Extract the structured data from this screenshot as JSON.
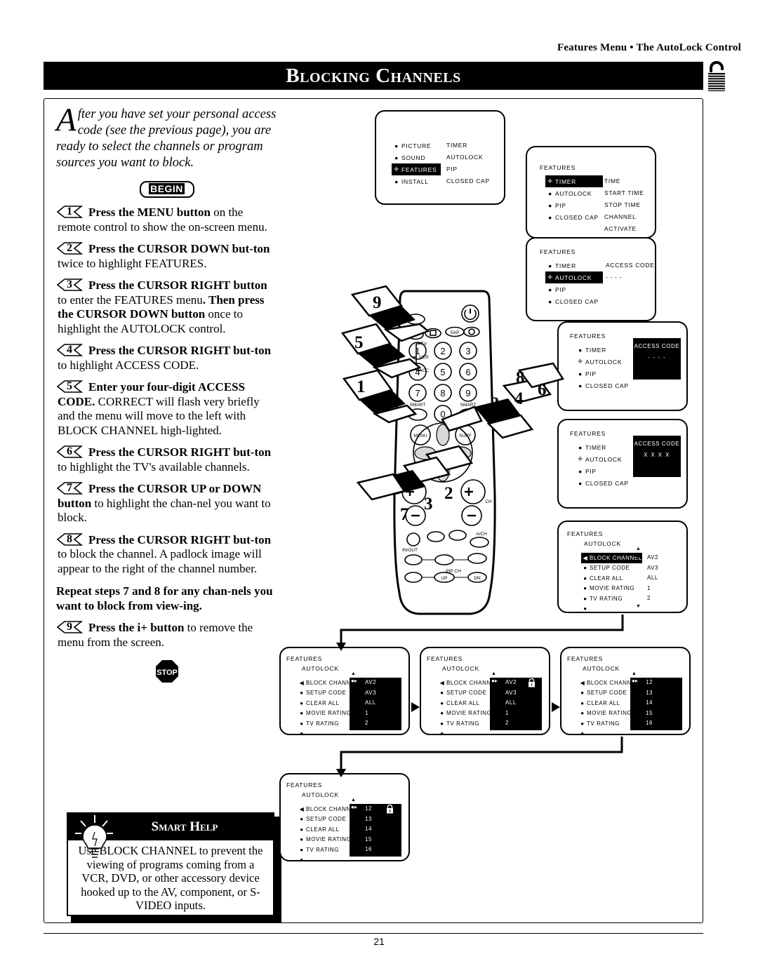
{
  "page": {
    "running_head": "Features Menu • The AutoLock Control",
    "title": "Blocking Channels",
    "page_number": "21",
    "lock_icon": "open-padlock-icon"
  },
  "intro": {
    "dropcap": "A",
    "text": "fter you have set your personal access code (see the previous page), you are ready to select the channels or program sources you want to block.",
    "begin_label": "BEGIN",
    "stop_label": "STOP"
  },
  "steps": [
    {
      "num": "1",
      "bold": "Press the MENU button",
      "rest": " on the remote control to show the on-screen menu."
    },
    {
      "num": "2",
      "bold": "Press the CURSOR DOWN but-",
      "rest": ""
    },
    {
      "num": "3",
      "bold": "Press the CURSOR RIGHT",
      "rest": ""
    },
    {
      "num": "4",
      "bold": "Press the CURSOR RIGHT but-",
      "rest": ""
    },
    {
      "num": "5",
      "bold": "Enter your four-digit ACCESS",
      "rest": ""
    },
    {
      "num": "6",
      "bold": "Press the CURSOR RIGHT but-",
      "rest": ""
    },
    {
      "num": "7",
      "bold": "Press the CURSOR UP or",
      "rest": ""
    },
    {
      "num": "8",
      "bold": "Press the CURSOR RIGHT but-",
      "rest": ""
    },
    {
      "num": "9",
      "bold": "Press the i+ button",
      "rest": " to remove the menu from the screen."
    }
  ],
  "step_text": {
    "s1_a": "Press the MENU button",
    "s1_b": " on the remote control to show the on-screen menu.",
    "s2_a": "Press the CURSOR DOWN but-",
    "s2_b": "ton",
    "s2_c": " twice to highlight FEATURES.",
    "s3_a": "Press the CURSOR RIGHT",
    "s3_b": "button",
    "s3_c": " to enter the FEATURES menu",
    "s3_d": ". Then ",
    "s3_e": "press the CURSOR DOWN button",
    "s3_f": " once to highlight the AUTOLOCK control.",
    "s4_a": "Press the CURSOR RIGHT but-",
    "s4_b": "ton",
    "s4_c": " to highlight ACCESS CODE.",
    "s5_a": "Enter your four-digit ACCESS CODE.",
    "s5_b": " CORRECT will flash very briefly and the menu will move to the left with BLOCK CHANNEL high-lighted.",
    "s6_a": "Press the CURSOR RIGHT but-",
    "s6_b": "ton",
    "s6_c": " to highlight the TV's available channels.",
    "s7_a": "Press the CURSOR UP or DOWN button",
    "s7_b": " to highlight the chan-nel you want to block.",
    "s8_a": "Press the CURSOR RIGHT but-",
    "s8_b": "ton",
    "s8_c": " to block the channel. A padlock image will appear to the right of the channel number.",
    "repeat": "Repeat steps 7 and 8 for any chan-nels you want to block from view-ing.",
    "s9_a": "Press the i+ button",
    "s9_b": " to remove the menu from the screen."
  },
  "smart_help": {
    "title": "Smart Help",
    "body": "Use BLOCK CHANNEL to prevent the viewing of programs coming from a VCR, DVD, or other accessory device hooked up to the AV, component, or S-VIDEO inputs.",
    "icon": "lightbulb-icon"
  },
  "screens": {
    "main_menu": {
      "left_items": [
        "PICTURE",
        "SOUND",
        "FEATURES",
        "INSTALL"
      ],
      "selected": "FEATURES",
      "right_items": [
        "TIMER",
        "AUTOLOCK",
        "PIP",
        "CLOSED CAP"
      ]
    },
    "features_timer": {
      "header": "FEATURES",
      "left_items": [
        "TIMER",
        "AUTOLOCK",
        "PIP",
        "CLOSED CAP"
      ],
      "selected": "TIMER",
      "right_items": [
        "TIME",
        "START TIME",
        "STOP TIME",
        "CHANNEL",
        "ACTIVATE"
      ]
    },
    "features_autolock": {
      "header": "FEATURES",
      "left_items": [
        "TIMER",
        "AUTOLOCK",
        "PIP",
        "CLOSED CAP"
      ],
      "selected": "AUTOLOCK",
      "right_label": "ACCESS CODE",
      "right_value": "- - - -",
      "value_highlighted": false
    },
    "access_code_empty": {
      "header": "FEATURES",
      "left_items": [
        "TIMER",
        "AUTOLOCK",
        "PIP",
        "CLOSED CAP"
      ],
      "selected": "AUTOLOCK",
      "right_label": "ACCESS CODE",
      "right_value": "- - - -",
      "value_highlighted": true
    },
    "access_code_entered": {
      "header": "FEATURES",
      "left_items": [
        "TIMER",
        "AUTOLOCK",
        "PIP",
        "CLOSED CAP"
      ],
      "selected": "AUTOLOCK",
      "right_label": "ACCESS CODE",
      "right_value": "X X X X",
      "value_highlighted": true
    },
    "autolock_block": {
      "header": "FEATURES",
      "subheader": "AUTOLOCK",
      "items": [
        "BLOCK CHANNEL",
        "SETUP CODE",
        "CLEAR ALL",
        "MOVIE RATING",
        "TV RATING"
      ],
      "selected": "BLOCK CHANNEL",
      "values": [
        "AV2",
        "AV3",
        "ALL",
        "1",
        "2"
      ],
      "values_highlighted": false,
      "padlock": false
    },
    "autolock_values": {
      "header": "FEATURES",
      "subheader": "AUTOLOCK",
      "items": [
        "BLOCK CHANNEL",
        "SETUP CODE",
        "CLEAR ALL",
        "MOVIE RATING",
        "TV RATING"
      ],
      "values": [
        "AV2",
        "AV3",
        "ALL",
        "1",
        "2"
      ],
      "values_highlighted": true,
      "padlock": false
    },
    "autolock_locked_av2": {
      "header": "FEATURES",
      "subheader": "AUTOLOCK",
      "items": [
        "BLOCK CHANNEL",
        "SETUP CODE",
        "CLEAR ALL",
        "MOVIE RATING",
        "TV RATING"
      ],
      "values": [
        "AV2",
        "AV3",
        "ALL",
        "1",
        "2"
      ],
      "values_highlighted": true,
      "padlock": true
    },
    "autolock_channels": {
      "header": "FEATURES",
      "subheader": "AUTOLOCK",
      "items": [
        "BLOCK CHANNEL",
        "SETUP CODE",
        "CLEAR ALL",
        "MOVIE RATING",
        "TV RATING"
      ],
      "values": [
        "12",
        "13",
        "14",
        "15",
        "16"
      ],
      "values_highlighted": true,
      "padlock": false
    },
    "autolock_locked_12": {
      "header": "FEATURES",
      "subheader": "AUTOLOCK",
      "items": [
        "BLOCK CHANNEL",
        "SETUP CODE",
        "CLEAR ALL",
        "MOVIE RATING",
        "TV RATING"
      ],
      "values": [
        "12",
        "13",
        "14",
        "15",
        "16"
      ],
      "values_highlighted": true,
      "padlock": true
    }
  },
  "remote": {
    "callouts": [
      "9",
      "5",
      "1",
      "8",
      "6",
      "3",
      "4",
      "2",
      "7"
    ],
    "keys": [
      "1",
      "2",
      "3",
      "4",
      "5",
      "6",
      "7",
      "8",
      "9",
      "0"
    ],
    "labels": {
      "sap": "SAP",
      "tv": "TV",
      "vcr": "VCR",
      "acc": "ACC",
      "smart_left": "SMART",
      "smart_right": "SMART",
      "menu": "MENU",
      "surf": "SURF",
      "ch": "CH",
      "ach": "A/CH",
      "inout": "IN/OUT",
      "pipch": "PIP CH",
      "up": "UP",
      "dn": "DN"
    }
  }
}
